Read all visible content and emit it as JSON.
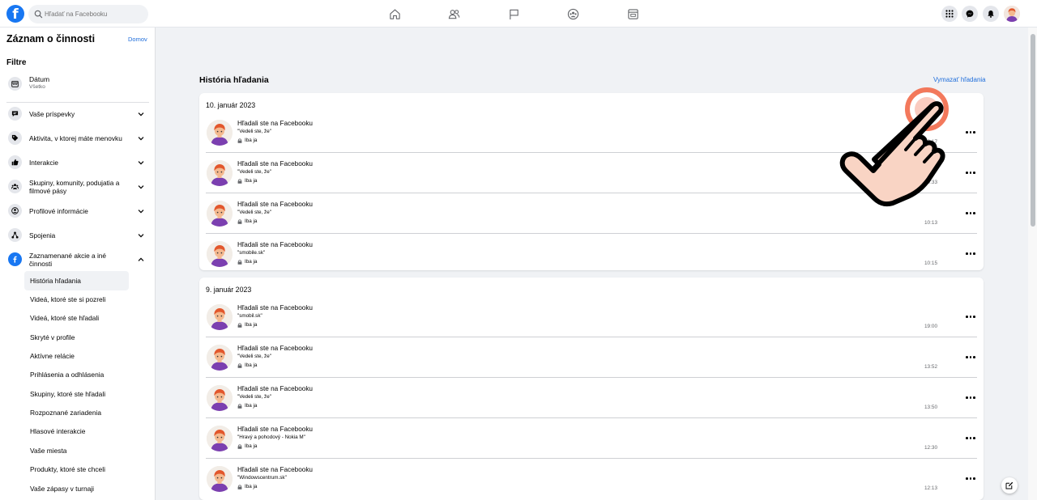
{
  "colors": {
    "brand": "#1877f2",
    "link": "#216fdb",
    "background": "#f0f2f5",
    "divider": "#ced0d4",
    "pointer_ring": "#f26a4a",
    "pointer_hand": "#f9d4c4"
  },
  "topbar": {
    "logo_icon": "facebook-logo",
    "search": {
      "placeholder": "Hľadať na Facebooku",
      "icon": "search-icon"
    },
    "nav_icons": [
      "home-icon",
      "friends-icon",
      "pages-flag-icon",
      "groups-icon",
      "gaming-icon"
    ],
    "right_icons": [
      "menu-grid-icon",
      "messenger-icon",
      "notifications-icon",
      "profile-avatar"
    ]
  },
  "sidebar": {
    "title": "Záznam o činnosti",
    "home_link": "Domov",
    "filters_label": "Filtre",
    "date_filter": {
      "label": "Dátum",
      "value": "Všetko",
      "icon": "calendar-icon"
    },
    "categories": [
      {
        "label": "Vaše príspevky",
        "icon": "post-icon",
        "expanded": false
      },
      {
        "label": "Aktivita, v ktorej máte menovku",
        "icon": "tag-icon",
        "expanded": false
      },
      {
        "label": "Interakcie",
        "icon": "like-icon",
        "expanded": false
      },
      {
        "label": "Skupiny, komunity, podujatia a filmové pásy",
        "icon": "groups-icon",
        "expanded": false
      },
      {
        "label": "Profilové informácie",
        "icon": "profile-icon",
        "expanded": false
      },
      {
        "label": "Spojenia",
        "icon": "connections-icon",
        "expanded": false
      },
      {
        "label": "Zaznamenané akcie a iné činnosti",
        "icon": "facebook-icon",
        "expanded": true
      }
    ],
    "subitems": [
      "História hľadania",
      "Videá, ktoré ste si pozreli",
      "Videá, ktoré ste hľadali",
      "Skryté v profile",
      "Aktívne relácie",
      "Prihlásenia a odhlásenia",
      "Skupiny, ktoré ste hľadali",
      "Rozpoznané zariadenia",
      "Hlasové interakcie",
      "Vaše miesta",
      "Produkty, ktoré ste chceli",
      "Vaše zápasy v turnaji"
    ],
    "active_subitem": "História hľadania"
  },
  "main": {
    "title": "História hľadania",
    "clear_link": "Vymazať hľadania",
    "groups": [
      {
        "date": "10. január 2023",
        "items": [
          {
            "title": "Hľadali ste na Facebooku",
            "query": "\"Vedeli ste, že\"",
            "privacy": "Iba ja",
            "time": "10:17"
          },
          {
            "title": "Hľadali ste na Facebooku",
            "query": "\"Vedeli ste, že\"",
            "privacy": "Iba ja",
            "time": "10:33"
          },
          {
            "title": "Hľadali ste na Facebooku",
            "query": "\"Vedeli ste, že\"",
            "privacy": "Iba ja",
            "time": "10:13"
          },
          {
            "title": "Hľadali ste na Facebooku",
            "query": "\"smobile.sk\"",
            "privacy": "Iba ja",
            "time": "10:15"
          }
        ]
      },
      {
        "date": "9. január 2023",
        "items": [
          {
            "title": "Hľadali ste na Facebooku",
            "query": "\"smobil.sk\"",
            "privacy": "Iba ja",
            "time": "19:00"
          },
          {
            "title": "Hľadali ste na Facebooku",
            "query": "\"Vedeli ste, že\"",
            "privacy": "Iba ja",
            "time": "13:52"
          },
          {
            "title": "Hľadali ste na Facebooku",
            "query": "\"Vedeli ste, že\"",
            "privacy": "Iba ja",
            "time": "13:50"
          },
          {
            "title": "Hľadali ste na Facebooku",
            "query": "\"Hravý a pohodový - Nokia M\"",
            "privacy": "Iba ja",
            "time": "12:30"
          },
          {
            "title": "Hľadali ste na Facebooku",
            "query": "\"Windowscentrum.sk\"",
            "privacy": "Iba ja",
            "time": "12:13"
          }
        ]
      }
    ],
    "row_menu_icon": "more-options-icon"
  },
  "compose_icon": "new-message-icon",
  "overlay": {
    "pointer_icon": "tap-hand-pointer"
  }
}
